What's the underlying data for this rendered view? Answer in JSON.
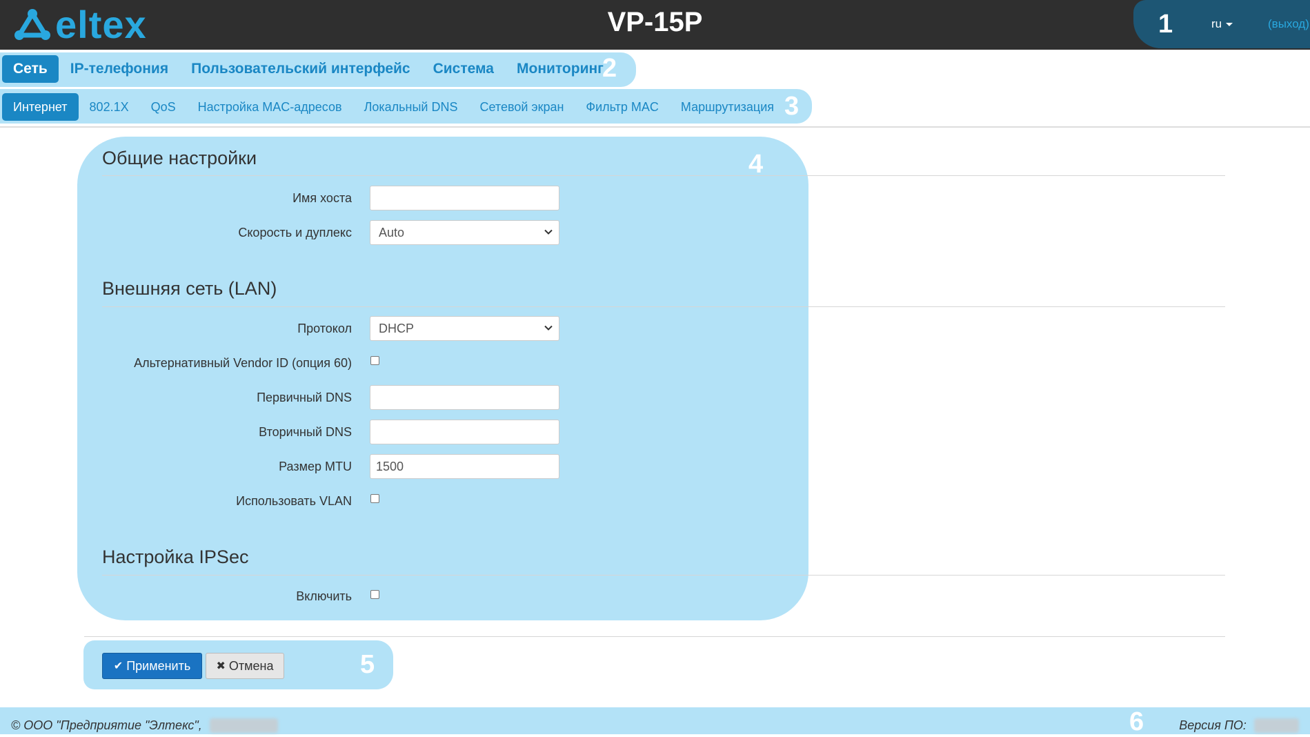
{
  "header": {
    "title": "VP-15P",
    "logo_text": "eltex",
    "lang": "ru",
    "logout": "(выход)",
    "callout": "1"
  },
  "nav": {
    "items": [
      {
        "label": "Сеть",
        "active": true
      },
      {
        "label": "IP-телефония"
      },
      {
        "label": "Пользовательский интерфейс"
      },
      {
        "label": "Система"
      },
      {
        "label": "Мониторинг"
      }
    ],
    "callout": "2"
  },
  "subnav": {
    "items": [
      {
        "label": "Интернет",
        "active": true
      },
      {
        "label": "802.1X"
      },
      {
        "label": "QoS"
      },
      {
        "label": "Настройка MAC-адресов"
      },
      {
        "label": "Локальный DNS"
      },
      {
        "label": "Сетевой экран"
      },
      {
        "label": "Фильтр MAC"
      },
      {
        "label": "Маршрутизация"
      }
    ],
    "callout": "3"
  },
  "form": {
    "callout": "4",
    "general": {
      "title": "Общие настройки",
      "hostname_label": "Имя хоста",
      "hostname_value": "",
      "speed_label": "Скорость и дуплекс",
      "speed_value": "Auto"
    },
    "lan": {
      "title": "Внешняя сеть (LAN)",
      "protocol_label": "Протокол",
      "protocol_value": "DHCP",
      "vendor_label": "Альтернативный Vendor ID (опция 60)",
      "vendor_checked": false,
      "dns1_label": "Первичный DNS",
      "dns1_value": "",
      "dns2_label": "Вторичный DNS",
      "dns2_value": "",
      "mtu_label": "Размер MTU",
      "mtu_value": "1500",
      "vlan_label": "Использовать VLAN",
      "vlan_checked": false
    },
    "ipsec": {
      "title": "Настройка IPSec",
      "enable_label": "Включить",
      "enable_checked": false
    }
  },
  "buttons": {
    "apply": "Применить",
    "cancel": "Отмена",
    "callout": "5"
  },
  "footer": {
    "copyright": "© ООО \"Предприятие \"Элтекс\",",
    "version_label": "Версия ПО:",
    "callout": "6"
  },
  "colors": {
    "header_bg": "#2f2f2f",
    "accent": "#1a87c4",
    "logo": "#29a8df",
    "highlight": "#b3e2f7",
    "apply_button": "#1a73c2"
  }
}
